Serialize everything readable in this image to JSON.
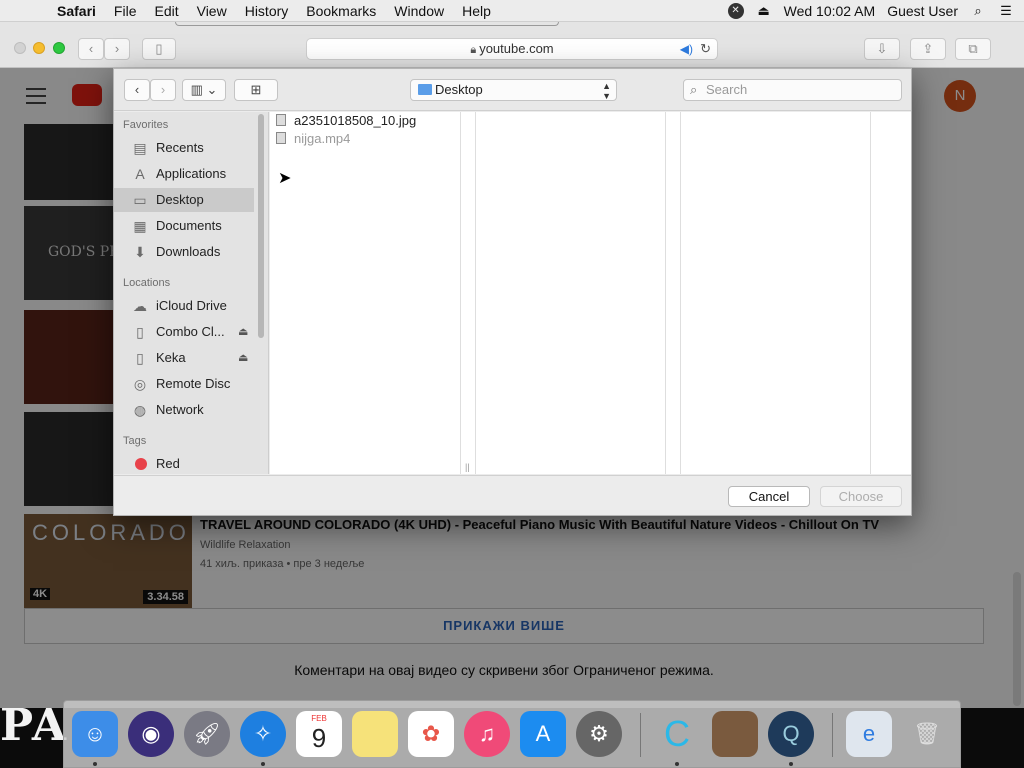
{
  "menubar": {
    "app_name": "Safari",
    "menus": [
      "File",
      "Edit",
      "View",
      "History",
      "Bookmarks",
      "Window",
      "Help"
    ],
    "clock": "Wed 10:02 AM",
    "user": "Guest User"
  },
  "safari": {
    "url": "youtube.com"
  },
  "youtube": {
    "avatar_letter": "N",
    "thumb_titles": [
      "GOD'S PR",
      "COLORADO"
    ],
    "colorado_duration": "3.34.58",
    "colorado_badge": "4K",
    "video_title": "TRAVEL AROUND COLORADO (4K UHD) - Peaceful Piano Music With Beautiful Nature Videos - Chillout On TV",
    "video_channel": "Wildlife Relaxation",
    "video_meta": "41 хиљ. приказа • пре 3 недеље",
    "show_more": "ПРИКАЖИ ВИШЕ",
    "comments_note": "Коментари на овај видео су скривени због Ограниченог режима."
  },
  "dialog": {
    "location": "Desktop",
    "search_placeholder": "Search",
    "sidebar": {
      "favorites_header": "Favorites",
      "favorites": [
        "Recents",
        "Applications",
        "Desktop",
        "Documents",
        "Downloads"
      ],
      "locations_header": "Locations",
      "locations": [
        "iCloud Drive",
        "Combo Cl...",
        "Keka",
        "Remote Disc",
        "Network"
      ],
      "tags_header": "Tags",
      "tags": [
        "Red"
      ]
    },
    "files": [
      {
        "name": "a2351018508_10.jpg",
        "enabled": true
      },
      {
        "name": "nijga.mp4",
        "enabled": false
      }
    ],
    "cancel_label": "Cancel",
    "choose_label": "Choose"
  },
  "dock": {
    "calendar_month": "FEB",
    "calendar_day": "9"
  },
  "desktop_text": "PA"
}
